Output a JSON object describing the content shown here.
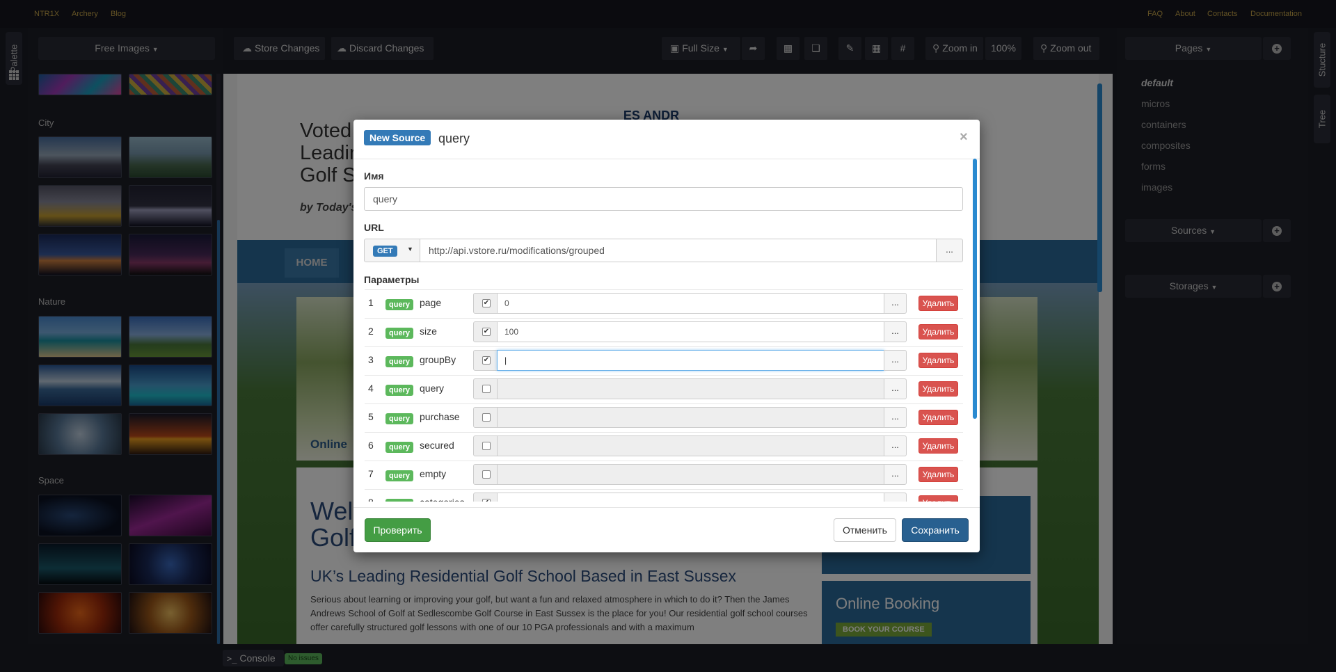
{
  "topnav": {
    "left_links": [
      "NTR1X",
      "Archery",
      "Blog"
    ],
    "right_links": [
      "FAQ",
      "About",
      "Contacts",
      "Documentation"
    ]
  },
  "side_tabs": {
    "palette": "Palette",
    "structure": "Stucture",
    "tree": "Tree"
  },
  "palette": {
    "dropdown": "Free Images",
    "categories": [
      "City",
      "Nature",
      "Space"
    ]
  },
  "toolbar": {
    "store": "Store Changes",
    "discard": "Discard Changes",
    "full_size": "Full Size",
    "zoom_in": "Zoom in",
    "zoom_level": "100%",
    "zoom_out": "Zoom out"
  },
  "right_panel": {
    "pages_dropdown": "Pages",
    "pages": [
      "default",
      "micros",
      "containers",
      "composites",
      "forms",
      "images"
    ],
    "sources_dropdown": "Sources",
    "storages_dropdown": "Storages"
  },
  "site_bg": {
    "heading_lines": [
      "Voted",
      "Leadin",
      "Golf S"
    ],
    "byline": "by Today's",
    "nav_home": "HOME",
    "online_partial": "Online",
    "welcome_lines": [
      "Wel",
      "Golf"
    ],
    "subheading": "UK’s Leading Residential Golf School Based in East Sussex",
    "paragraph": "Serious about learning or improving your golf, but want a fun and relaxed atmosphere in which to do it? Then the James Andrews School of Golf at Sedlescombe Golf Course in East Sussex is the place for you! Our residential golf school courses offer carefully structured golf lessons with one of our 10 PGA professionals and with a maximum",
    "online_booking": "Online Booking",
    "book_course": "BOOK YOUR COURSE",
    "logo_text": "ES ANDR"
  },
  "modal": {
    "badge": "New Source",
    "title": "query",
    "name_label": "Имя",
    "name_value": "query",
    "url_label": "URL",
    "method": "GET",
    "url_value": "http://api.vstore.ru/modifications/grouped",
    "url_more": "...",
    "params_label": "Параметры",
    "params": [
      {
        "num": "1",
        "type": "query",
        "name": "page",
        "checked": true,
        "value": "0"
      },
      {
        "num": "2",
        "type": "query",
        "name": "size",
        "checked": true,
        "value": "100"
      },
      {
        "num": "3",
        "type": "query",
        "name": "groupBy",
        "checked": true,
        "value": ""
      },
      {
        "num": "4",
        "type": "query",
        "name": "query",
        "checked": false,
        "value": ""
      },
      {
        "num": "5",
        "type": "query",
        "name": "purchase",
        "checked": false,
        "value": ""
      },
      {
        "num": "6",
        "type": "query",
        "name": "secured",
        "checked": false,
        "value": ""
      },
      {
        "num": "7",
        "type": "query",
        "name": "empty",
        "checked": false,
        "value": ""
      },
      {
        "num": "8",
        "type": "query",
        "name": "categories",
        "checked": true,
        "value": ""
      }
    ],
    "more_label": "...",
    "delete_label": "Удалить",
    "check_button": "Проверить",
    "cancel_button": "Отменить",
    "save_button": "Сохранить",
    "close": "×"
  },
  "console": {
    "label": "Console",
    "status": "No issues"
  },
  "colors": {
    "accent_blue": "#337ab7",
    "success_green": "#5cb85c",
    "danger_red": "#d9534f",
    "nav_gold": "#c8a64a"
  }
}
